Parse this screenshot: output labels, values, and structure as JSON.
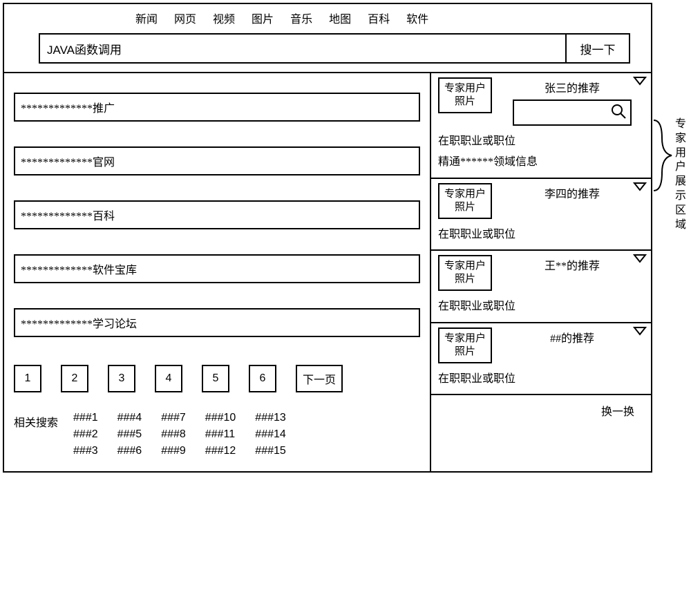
{
  "tabs": [
    "新闻",
    "网页",
    "视频",
    "图片",
    "音乐",
    "地图",
    "百科",
    "软件"
  ],
  "search": {
    "query": "JAVA函数调用",
    "button": "搜一下"
  },
  "results": [
    "*************推广",
    "*************官网",
    "*************百科",
    "*************软件宝库",
    "*************学习论坛"
  ],
  "pagination": {
    "pages": [
      "1",
      "2",
      "3",
      "4",
      "5",
      "6"
    ],
    "next": "下一页"
  },
  "related": {
    "label": "相关搜索",
    "columns": [
      [
        "###1",
        "###2",
        "###3"
      ],
      [
        "###4",
        "###5",
        "###6"
      ],
      [
        "###7",
        "###8",
        "###9"
      ],
      [
        "###10",
        "###11",
        "###12"
      ],
      [
        "###13",
        "###14",
        "###15"
      ]
    ]
  },
  "experts": [
    {
      "photo_l1": "专家用户",
      "photo_l2": "照片",
      "title": "张三的推荐",
      "has_search": true,
      "info": [
        "在职职业或职位",
        "精通******领域信息"
      ]
    },
    {
      "photo_l1": "专家用户",
      "photo_l2": "照片",
      "title": "李四的推荐",
      "has_search": false,
      "info": [
        "在职职业或职位"
      ]
    },
    {
      "photo_l1": "专家用户",
      "photo_l2": "照片",
      "title": "王**的推荐",
      "has_search": false,
      "info": [
        "在职职业或职位"
      ]
    },
    {
      "photo_l1": "专家用户",
      "photo_l2": "照片",
      "title": "##的推荐",
      "has_search": false,
      "info": [
        "在职职业或职位"
      ]
    }
  ],
  "refresh": "换一换",
  "side_label": "专家用户展示区域"
}
